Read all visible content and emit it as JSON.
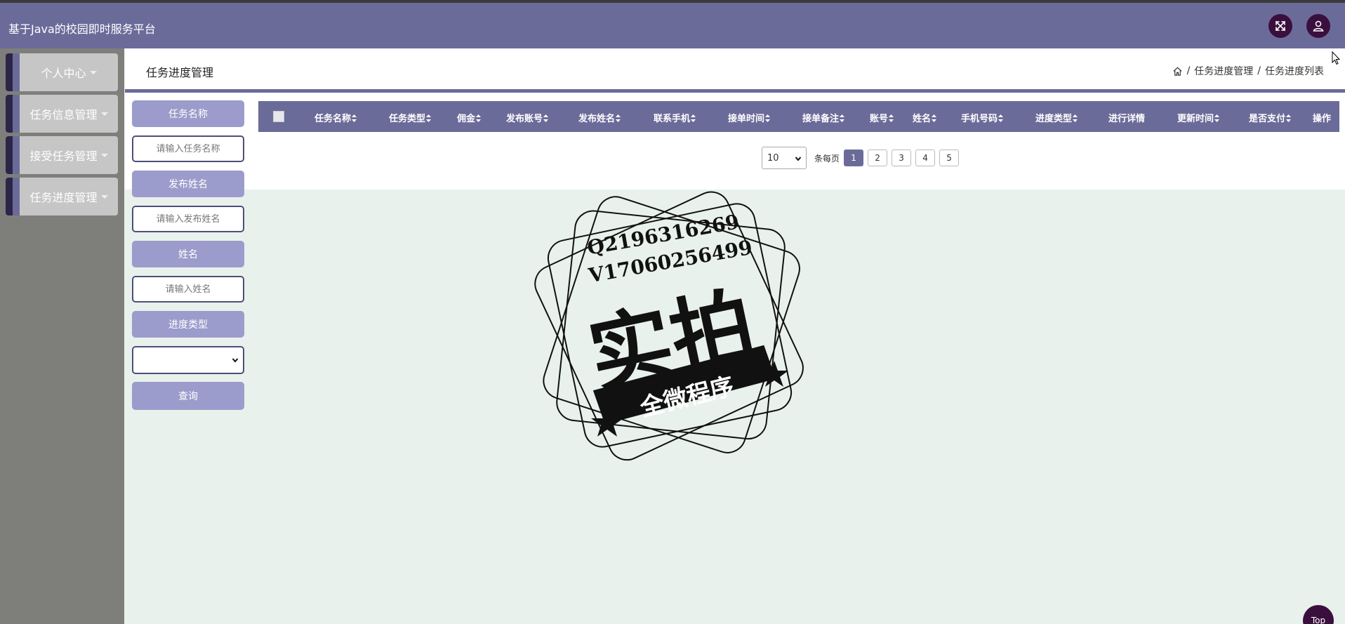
{
  "app": {
    "title": "基于Java的校园即时服务平台"
  },
  "topbar": {
    "fullscreen_icon": "fullscreen-icon",
    "user_icon": "user-icon"
  },
  "sidebar": {
    "items": [
      {
        "label": "个人中心"
      },
      {
        "label": "任务信息管理"
      },
      {
        "label": "接受任务管理"
      },
      {
        "label": "任务进度管理"
      }
    ]
  },
  "header": {
    "page_title": "任务进度管理",
    "breadcrumb": {
      "home_icon": "home-icon",
      "separator": "/",
      "level1": "任务进度管理",
      "level2": "任务进度列表"
    }
  },
  "search": {
    "task_name_label": "任务名称",
    "task_name_placeholder": "请输入任务名称",
    "publisher_name_label": "发布姓名",
    "publisher_name_placeholder": "请输入发布姓名",
    "name_label": "姓名",
    "name_placeholder": "请输入姓名",
    "progress_type_label": "进度类型",
    "progress_type_value": "",
    "query_button": "查询"
  },
  "table": {
    "columns": [
      "任务名称",
      "任务类型",
      "佣金",
      "发布账号",
      "发布姓名",
      "联系手机",
      "接单时间",
      "接单备注",
      "账号",
      "姓名",
      "手机号码",
      "进度类型",
      "进行详情",
      "更新时间",
      "是否支付",
      "操作"
    ],
    "rows": []
  },
  "pagination": {
    "page_size": "10",
    "per_page_label": "条每页",
    "pages": [
      "1",
      "2",
      "3",
      "4",
      "5"
    ],
    "current": "1"
  },
  "watermark": {
    "line1": "Q2196316269",
    "line2": "V17060256499",
    "main": "实拍",
    "banner": "全微程序"
  },
  "fab": {
    "label": "Top"
  },
  "colors": {
    "primary": "#6b6b9a",
    "accent_dark": "#3a0f3d",
    "sidebar_bg": "#7e7f7b",
    "button_light": "#9b9ccb",
    "page_bg": "#e8f1ec"
  }
}
